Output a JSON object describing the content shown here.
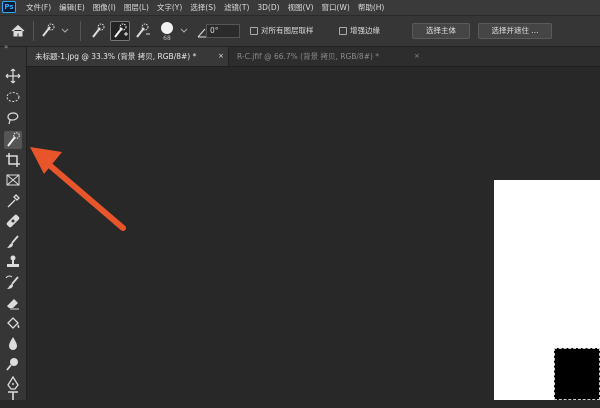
{
  "app": {
    "logo_text": "Ps"
  },
  "menu": {
    "items": [
      "文件(F)",
      "编辑(E)",
      "图像(I)",
      "图层(L)",
      "文字(Y)",
      "选择(S)",
      "滤镜(T)",
      "3D(D)",
      "视图(V)",
      "窗口(W)",
      "帮助(H)"
    ]
  },
  "options_bar": {
    "brush_size": "68",
    "angle_value": "0°",
    "sample_all_layers_label": "对所有图层取样",
    "sample_all_layers_checked": false,
    "enhance_edge_label": "增强边缘",
    "enhance_edge_checked": false,
    "select_subject_label": "选择主体",
    "select_and_mask_label": "选择并遮住 ..."
  },
  "tabs": [
    {
      "label": "未标题-1.jpg @ 33.3% (背景 拷贝, RGB/8#) *",
      "close": "×",
      "active": true
    },
    {
      "label": "R-C.jfif @ 66.7% (背景 拷贝, RGB/8#) *",
      "close": "×",
      "active": false
    }
  ],
  "toolbar": {
    "collapse_glyph": "»",
    "tools": [
      "move-tool",
      "ellipse-marquee-tool",
      "lasso-tool",
      "quick-selection-tool",
      "crop-tool",
      "frame-tool",
      "eyedropper-tool",
      "spot-healing-brush-tool",
      "brush-tool",
      "clone-stamp-tool",
      "history-brush-tool",
      "eraser-tool",
      "paint-bucket-tool",
      "blur-tool",
      "dodge-tool",
      "pen-tool",
      "type-tool"
    ],
    "selected_tool": "quick-selection-tool"
  },
  "colors": {
    "accent_arrow": "#e8552b",
    "ps_blue": "#31a8ff",
    "ui_dark": "#282828",
    "panel": "#363636"
  }
}
